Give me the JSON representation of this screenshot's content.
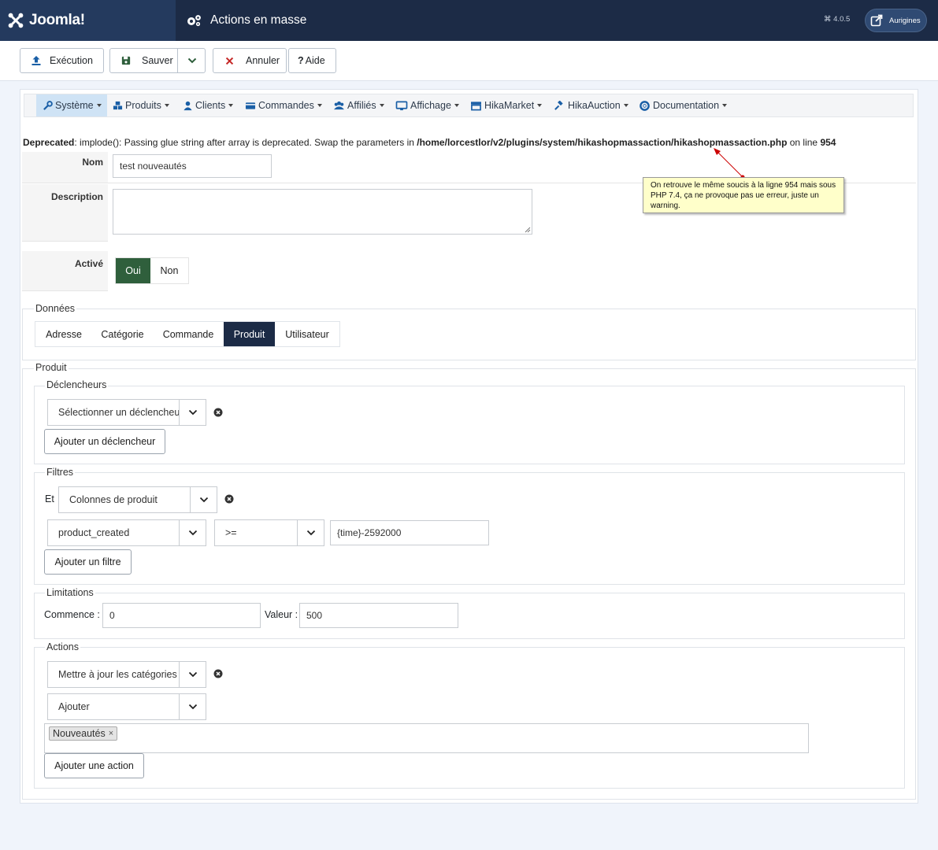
{
  "header": {
    "brand": "Joomla!",
    "title": "Actions en masse",
    "version": "4.0.5",
    "site_button": "Aurigines"
  },
  "toolbar": {
    "execute": "Exécution",
    "save": "Sauver",
    "cancel": "Annuler",
    "help": "Aide"
  },
  "menu": {
    "items": [
      "Système",
      "Produits",
      "Clients",
      "Commandes",
      "Affiliés",
      "Affichage",
      "HikaMarket",
      "HikaAuction",
      "Documentation"
    ]
  },
  "deprecated": {
    "label": "Deprecated",
    "text": ": implode(): Passing glue string after array is deprecated. Swap the parameters in ",
    "path": "/home/lorcestlor/v2/plugins/system/hikashopmassaction/hikashopmassaction.php",
    "on_line": " on line ",
    "line": "954"
  },
  "form": {
    "name_label": "Nom",
    "name_value": "test nouveautés",
    "description_label": "Description",
    "active_label": "Activé",
    "yes": "Oui",
    "no": "Non"
  },
  "data_section": {
    "legend": "Données",
    "tabs": [
      "Adresse",
      "Catégorie",
      "Commande",
      "Produit",
      "Utilisateur"
    ],
    "active_tab": "Produit"
  },
  "product": {
    "legend": "Produit",
    "triggers": {
      "legend": "Déclencheurs",
      "select": "Sélectionner un déclencheur",
      "add": "Ajouter un déclencheur"
    },
    "filters": {
      "legend": "Filtres",
      "prefix": "Et",
      "type": "Colonnes de produit",
      "column": "product_created",
      "operator": ">=",
      "value": "{time}-2592000",
      "add": "Ajouter un filtre"
    },
    "limits": {
      "legend": "Limitations",
      "start_label": "Commence :",
      "start_value": "0",
      "value_label": "Valeur :",
      "value_value": "500"
    },
    "actions": {
      "legend": "Actions",
      "action": "Mettre à jour les catégories",
      "mode": "Ajouter",
      "tag": "Nouveautés",
      "add": "Ajouter une action"
    }
  },
  "annotation": {
    "text": "On retrouve le même soucis à la ligne 954 mais sous PHP 7.4, ça ne provoque pas ue erreur, juste un warning."
  },
  "colors": {
    "header": "#1c2b46",
    "accent_green": "#2f5f3c",
    "active_tab": "#1c2b46",
    "cancel_red": "#c52827"
  }
}
